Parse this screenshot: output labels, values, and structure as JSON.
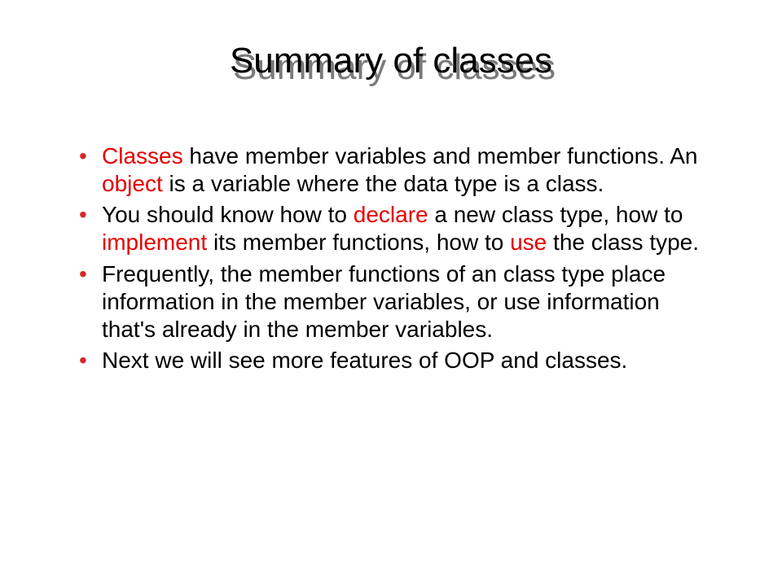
{
  "title": "Summary of classes",
  "bullets": [
    {
      "segments": [
        {
          "text": "Classes",
          "kw": true
        },
        {
          "text": " have member variables and member functions. An "
        },
        {
          "text": "object",
          "kw": true
        },
        {
          "text": " is a variable where the data type is a class."
        }
      ]
    },
    {
      "segments": [
        {
          "text": "You should know how to "
        },
        {
          "text": "declare",
          "kw": true
        },
        {
          "text": " a new class type, how to "
        },
        {
          "text": "implement",
          "kw": true
        },
        {
          "text": " its member functions, how to "
        },
        {
          "text": "use",
          "kw": true
        },
        {
          "text": " the class type."
        }
      ]
    },
    {
      "segments": [
        {
          "text": "Frequently, the member functions of an class type place information in the member variables, or use information that's already in the member variables."
        }
      ]
    },
    {
      "segments": [
        {
          "text": "Next we will see more features of OOP and classes."
        }
      ]
    }
  ],
  "colors": {
    "keyword": "#e60000",
    "bullet": "#d62828",
    "shadow": "#7a7a7a"
  }
}
